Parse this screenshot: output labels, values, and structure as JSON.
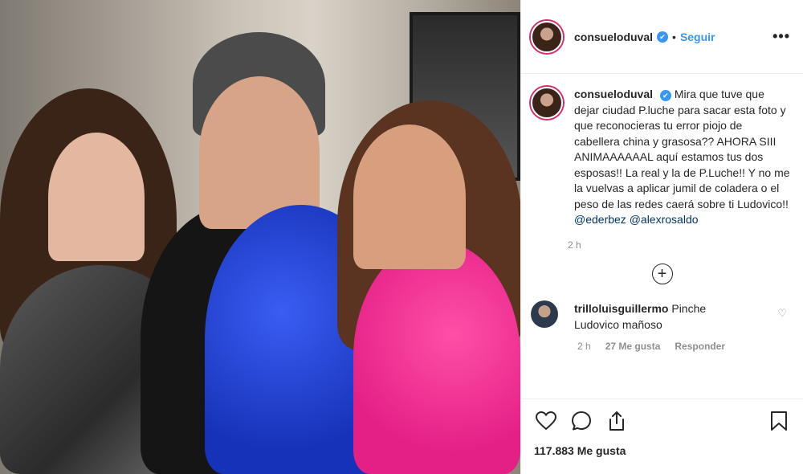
{
  "header": {
    "username": "consueloduval",
    "verified_icon": "✔",
    "separator": "•",
    "follow_label": "Seguir",
    "more_label": "•••"
  },
  "caption": {
    "username": "consueloduval",
    "text_before": "Mira que tuve que dejar ciudad P.luche para sacar esta foto y que reconocieras tu error piojo de cabellera china y grasosa?? AHORA SIII ANIMAAAAAAL aquí estamos tus dos esposas!! La real y la de P.Luche!! Y no me la vuelvas a aplicar jumil de coladera o el peso de las redes caerá sobre ti Ludovico!! ",
    "mention_1": "@ederbez",
    "mention_2": "@alexrosaldo",
    "time": "2 h"
  },
  "load_more_icon": "+",
  "comments": [
    {
      "username": "trilloluisguillermo",
      "text": "Pinche Ludovico mañoso",
      "time": "2 h",
      "likes": "27 Me gusta",
      "reply_label": "Responder",
      "like_icon": "♡"
    }
  ],
  "actions": {
    "like_icon": "heart-outline-icon",
    "comment_icon": "comment-bubble-icon",
    "share_icon": "share-icon",
    "save_icon": "bookmark-icon",
    "likes_count": "117.883 Me gusta"
  }
}
